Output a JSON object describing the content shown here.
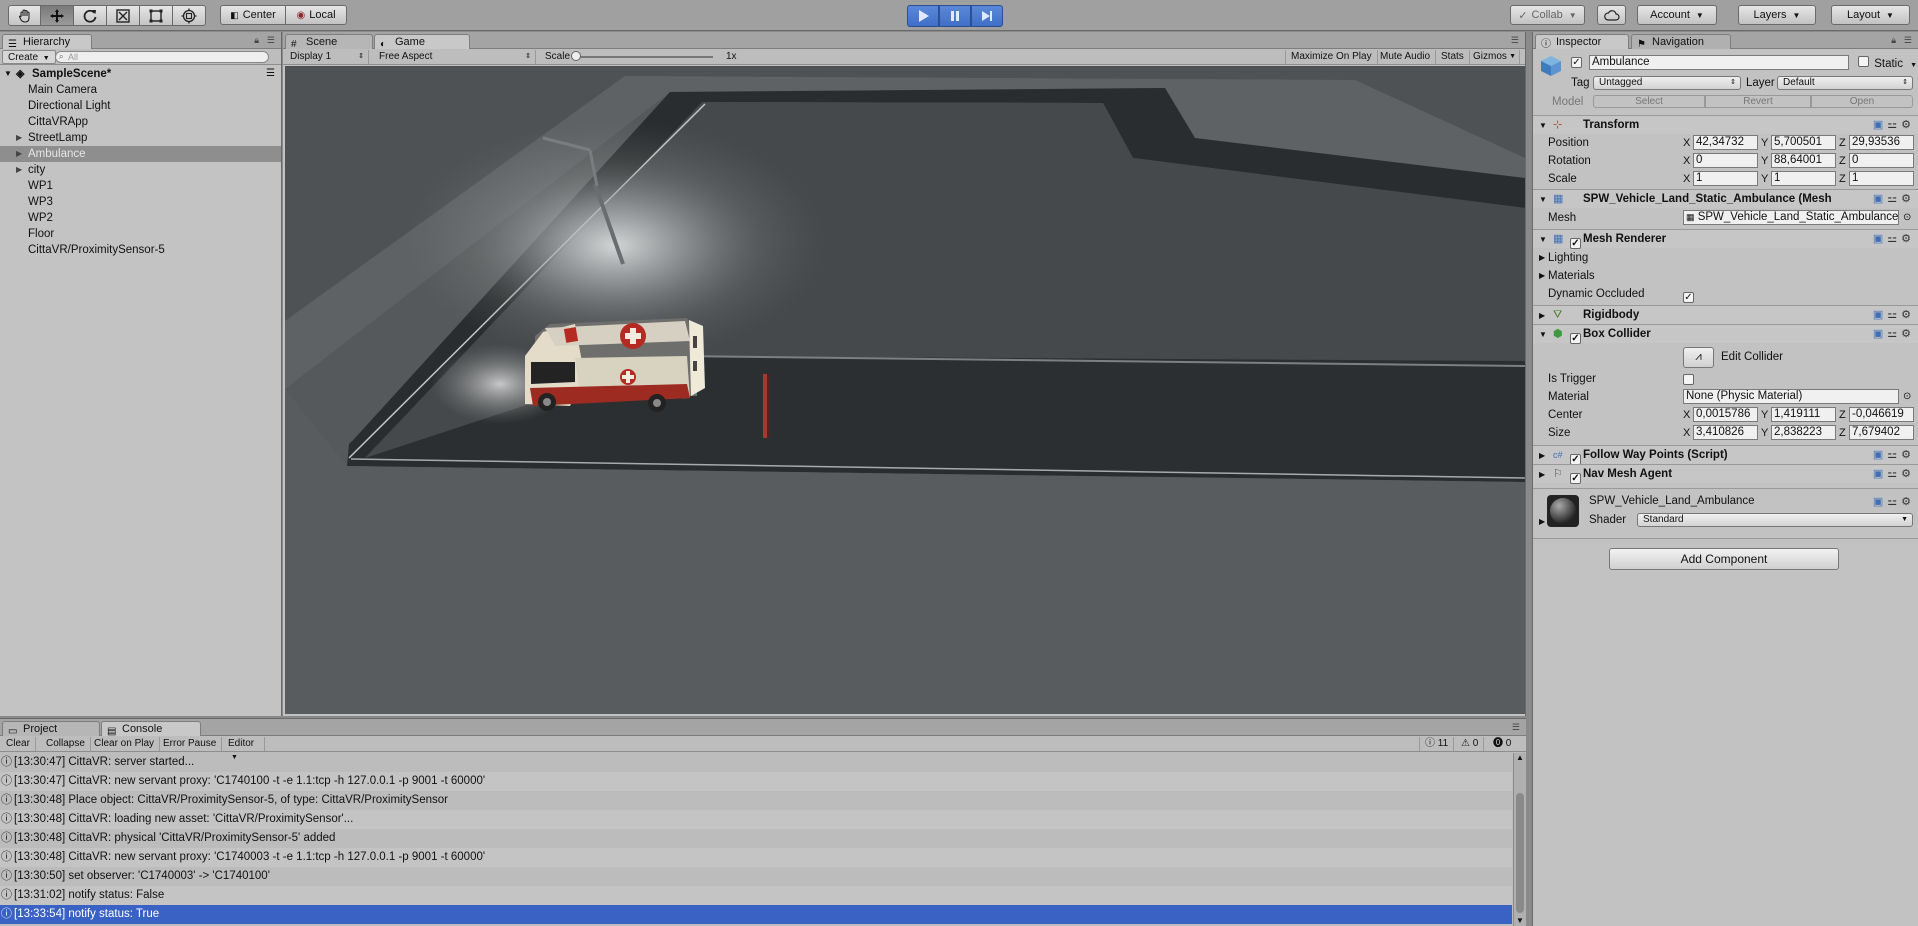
{
  "toolbar": {
    "tools": [
      "hand-tool-icon",
      "move-tool-icon",
      "rotate-tool-icon",
      "scale-tool-icon",
      "rect-tool-icon",
      "transform-tool-icon"
    ],
    "pivot_label": "Center",
    "space_label": "Local",
    "collab_label": "Collab",
    "account_label": "Account",
    "layers_label": "Layers",
    "layout_label": "Layout"
  },
  "hierarchy": {
    "tab_label": "Hierarchy",
    "create_label": "Create",
    "search_placeholder": "All",
    "scene_name": "SampleScene*",
    "items": [
      {
        "label": "Main Camera",
        "expandable": false
      },
      {
        "label": "Directional Light",
        "expandable": false
      },
      {
        "label": "CittaVRApp",
        "expandable": false
      },
      {
        "label": "StreetLamp",
        "expandable": true
      },
      {
        "label": "Ambulance",
        "expandable": true,
        "selected": true
      },
      {
        "label": "city",
        "expandable": true
      },
      {
        "label": "WP1",
        "expandable": false
      },
      {
        "label": "WP3",
        "expandable": false
      },
      {
        "label": "WP2",
        "expandable": false
      },
      {
        "label": "Floor",
        "expandable": false
      },
      {
        "label": "CittaVR/ProximitySensor-5",
        "expandable": false
      }
    ]
  },
  "game": {
    "tab_scene": "Scene",
    "tab_game": "Game",
    "display": "Display 1",
    "aspect": "Free Aspect",
    "scale_label": "Scale",
    "scale_value": "1x",
    "maximize_label": "Maximize On Play",
    "mute_label": "Mute Audio",
    "stats_label": "Stats",
    "gizmos_label": "Gizmos"
  },
  "inspector": {
    "tab_inspector": "Inspector",
    "tab_navigation": "Navigation",
    "object_name": "Ambulance",
    "static_label": "Static",
    "tag_label": "Tag",
    "tag_value": "Untagged",
    "layer_label": "Layer",
    "layer_value": "Default",
    "model_label": "Model",
    "select_label": "Select",
    "revert_label": "Revert",
    "open_label": "Open",
    "transform": {
      "title": "Transform",
      "position_label": "Position",
      "rotation_label": "Rotation",
      "scale_label": "Scale",
      "position": {
        "x": "42,34732",
        "y": "5,700501",
        "z": "29,93536"
      },
      "rotation": {
        "x": "0",
        "y": "88,64001",
        "z": "0"
      },
      "scale": {
        "x": "1",
        "y": "1",
        "z": "1"
      }
    },
    "mesh_filter": {
      "title": "SPW_Vehicle_Land_Static_Ambulance (Mesh Fil",
      "mesh_label": "Mesh",
      "mesh_value": "SPW_Vehicle_Land_Static_Ambulance"
    },
    "mesh_renderer": {
      "title": "Mesh Renderer",
      "lighting_label": "Lighting",
      "materials_label": "Materials",
      "dynamic_occluded_label": "Dynamic Occluded"
    },
    "rigidbody": {
      "title": "Rigidbody"
    },
    "box_collider": {
      "title": "Box Collider",
      "edit_collider_label": "Edit Collider",
      "is_trigger_label": "Is Trigger",
      "material_label": "Material",
      "material_value": "None (Physic Material)",
      "center_label": "Center",
      "size_label": "Size",
      "center": {
        "x": "0,0015786",
        "y": "1,419111",
        "z": "-0,046619"
      },
      "size": {
        "x": "3,410826",
        "y": "2,838223",
        "z": "7,679402"
      }
    },
    "follow_way_points": {
      "title": "Follow Way Points (Script)"
    },
    "nav_mesh_agent": {
      "title": "Nav Mesh Agent"
    },
    "material": {
      "name": "SPW_Vehicle_Land_Ambulance",
      "shader_label": "Shader",
      "shader_value": "Standard"
    },
    "add_component_label": "Add Component"
  },
  "console": {
    "tab_project": "Project",
    "tab_console": "Console",
    "clear_label": "Clear",
    "collapse_label": "Collapse",
    "clear_on_play_label": "Clear on Play",
    "error_pause_label": "Error Pause",
    "editor_label": "Editor",
    "info_count": "11",
    "warning_count": "0",
    "error_count": "0",
    "logs": [
      "[13:30:47] CittaVR: server started...",
      "[13:30:47] CittaVR: new servant proxy: 'C1740100 -t -e 1.1:tcp -h 127.0.0.1 -p 9001 -t 60000'",
      "[13:30:48] Place object: CittaVR/ProximitySensor-5, of type: CittaVR/ProximitySensor",
      "[13:30:48] CittaVR: loading new asset: 'CittaVR/ProximitySensor'...",
      "[13:30:48] CittaVR: physical 'CittaVR/ProximitySensor-5' added",
      "[13:30:48] CittaVR: new servant proxy: 'C1740003 -t -e 1.1:tcp -h 127.0.0.1 -p 9001 -t 60000'",
      "[13:30:50] set observer: 'C1740003' -> 'C1740100'",
      "[13:31:02] notify status: False",
      "[13:33:54] notify status: True"
    ]
  }
}
